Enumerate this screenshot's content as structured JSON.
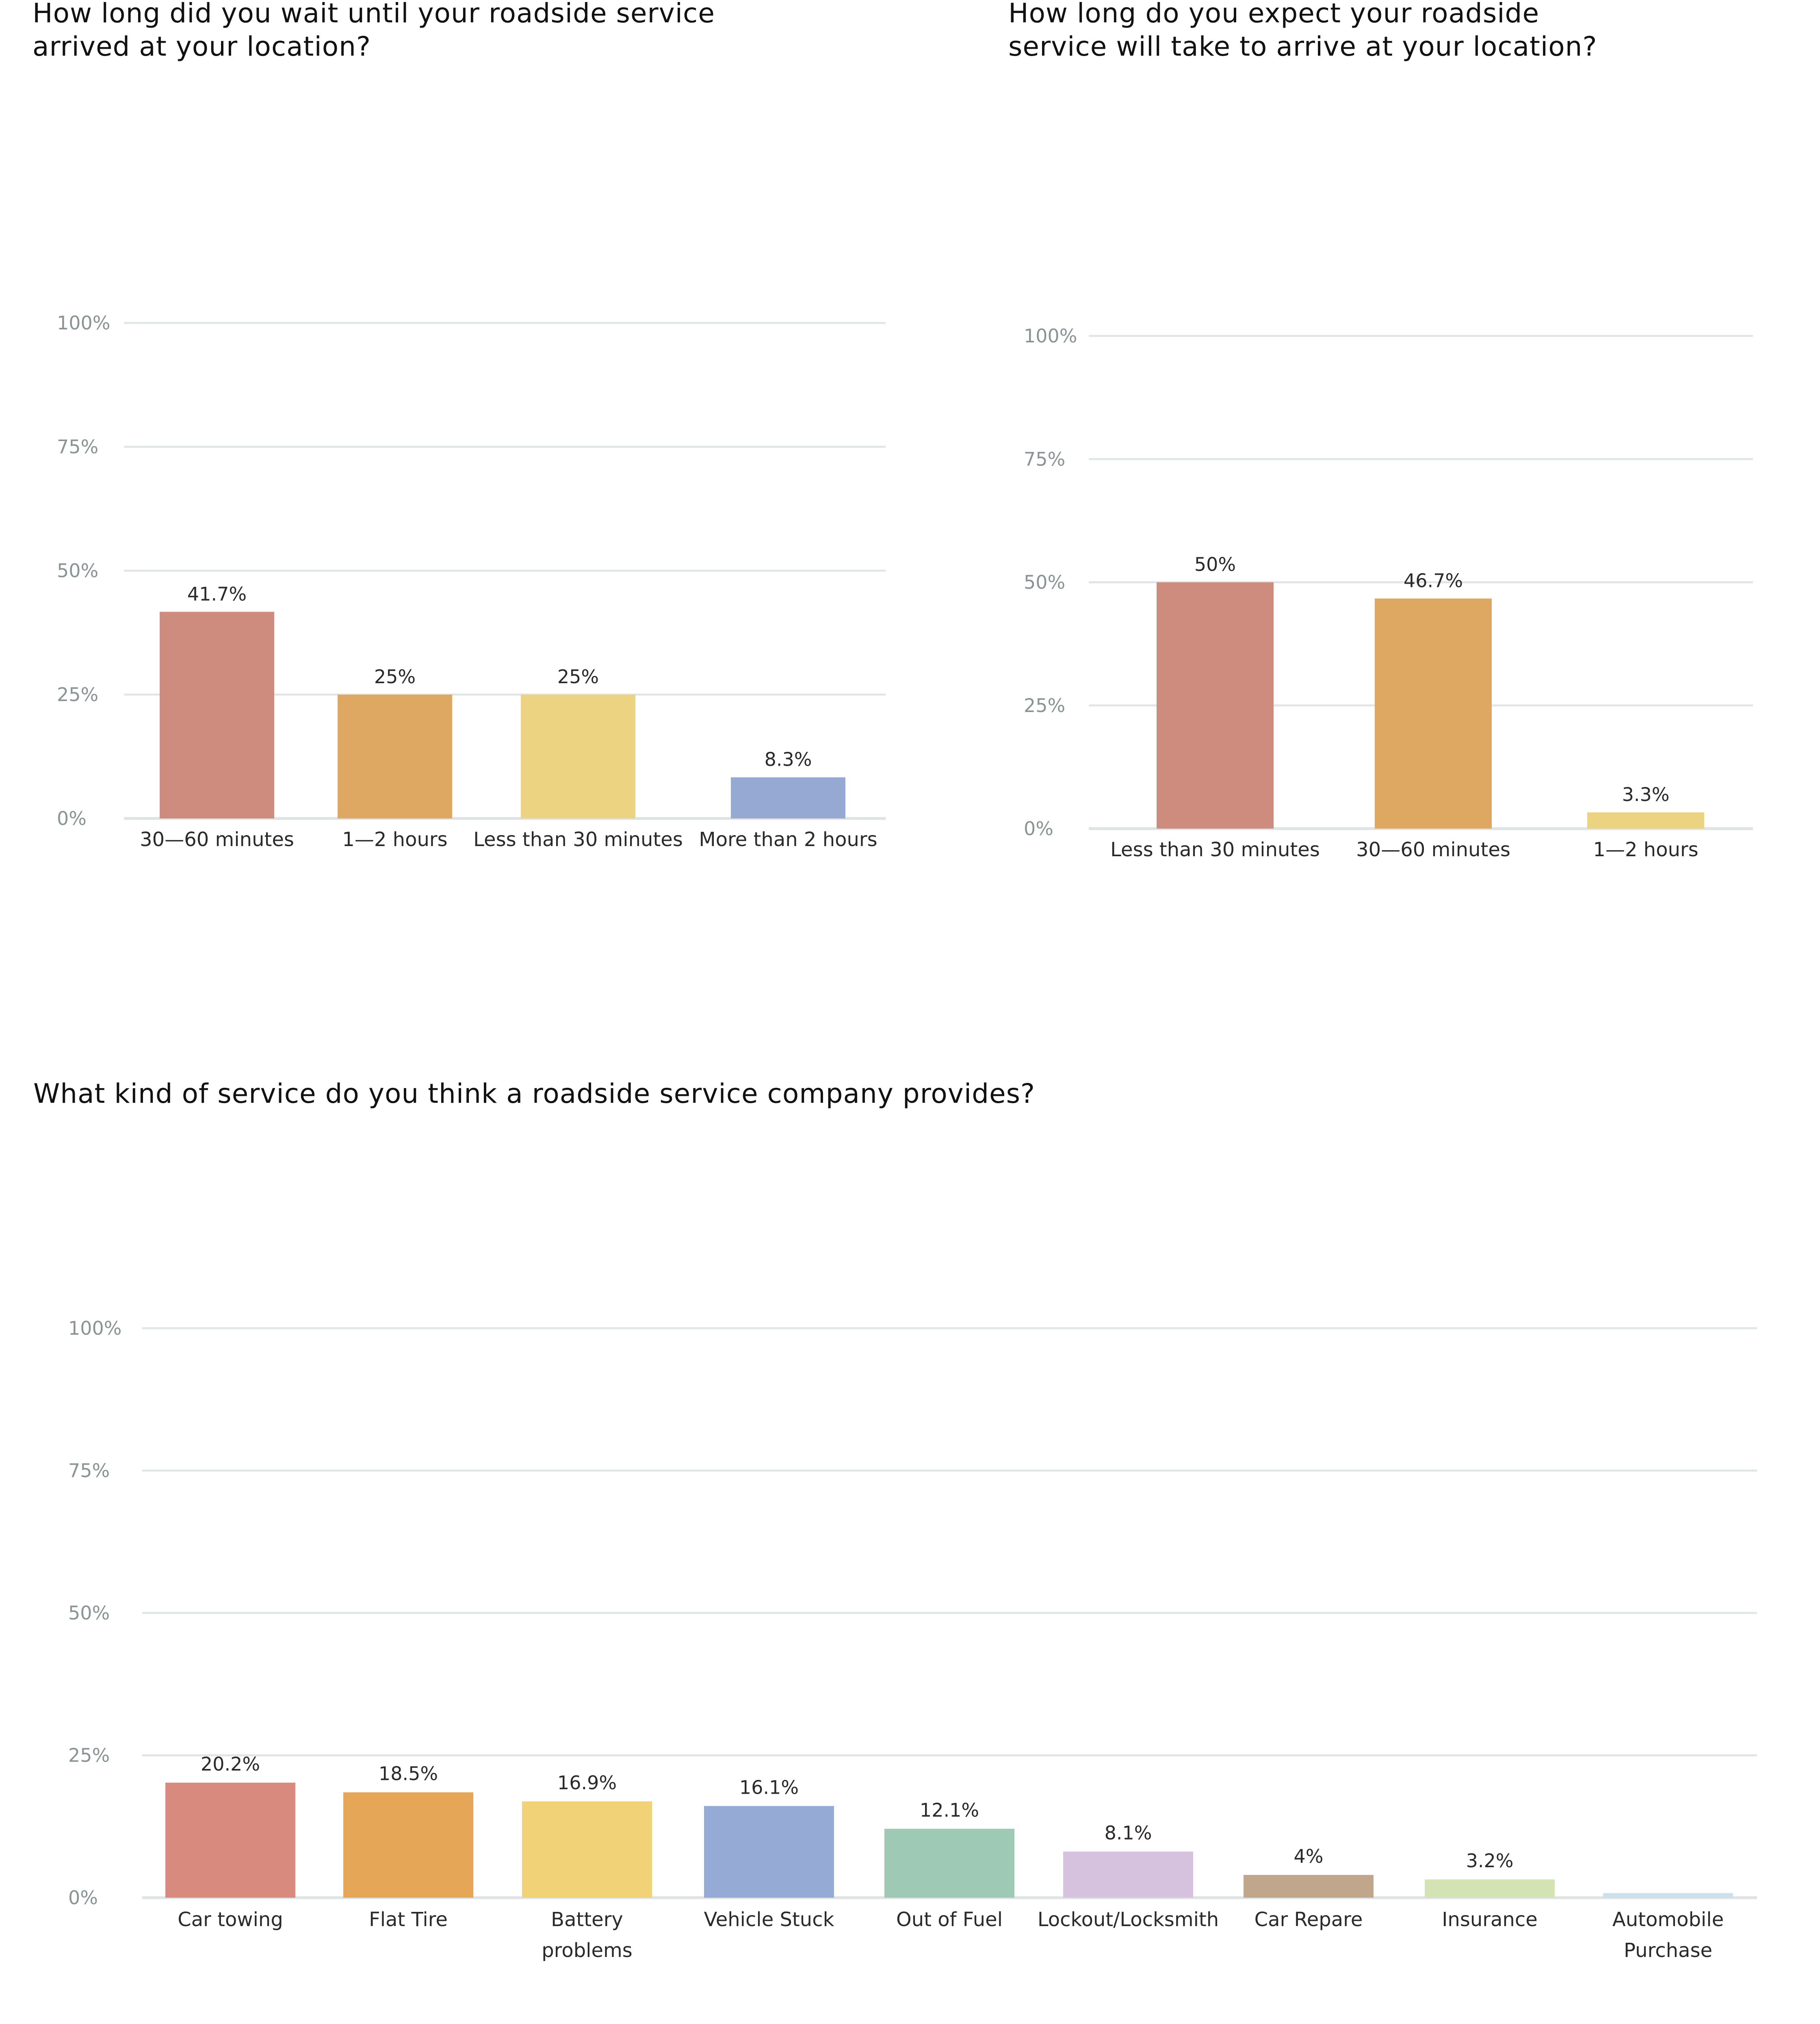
{
  "chart_data": [
    {
      "type": "bar",
      "title": "How long did you wait until your roadside service arrived at your location?",
      "title_lines": [
        "How long did you wait until your roadside service",
        "arrived at your location?"
      ],
      "categories": [
        "30—60 minutes",
        "1—2 hours",
        "Less than 30 minutes",
        "More than 2 hours"
      ],
      "values": [
        41.7,
        25,
        25,
        8.3
      ],
      "data_labels": [
        "41.7%",
        "25%",
        "25%",
        "8.3%"
      ],
      "colors": [
        "#cd8c7e",
        "#dea762",
        "#ecd382",
        "#96a9d2"
      ],
      "yticks": [
        "0%",
        "25%",
        "50%",
        "75%",
        "100%"
      ],
      "ylim": [
        0,
        100
      ],
      "xlabel": "",
      "ylabel": "",
      "grid": true,
      "legend": "none"
    },
    {
      "type": "bar",
      "title": "How long do you expect your roadside service will take to arrive at your location?",
      "title_lines": [
        "How long do you expect your roadside",
        "service will take to arrive at your location?"
      ],
      "categories": [
        "Less than 30 minutes",
        "30—60 minutes",
        "1—2 hours"
      ],
      "values": [
        50,
        46.7,
        3.3
      ],
      "data_labels": [
        "50%",
        "46.7%",
        "3.3%"
      ],
      "colors": [
        "#cd8c7e",
        "#dea762",
        "#ecd382"
      ],
      "yticks": [
        "0%",
        "25%",
        "50%",
        "75%",
        "100%"
      ],
      "ylim": [
        0,
        100
      ],
      "xlabel": "",
      "ylabel": "",
      "grid": true,
      "legend": "none"
    },
    {
      "type": "bar",
      "title": "What kind of service do you think a roadside service company provides?",
      "title_lines": [
        "What kind of service do you think a roadside service company provides?"
      ],
      "categories": [
        "Car towing",
        "Flat Tire",
        "Battery problems",
        "Vehicle Stuck",
        "Out of Fuel",
        "Lockout/Locksmith",
        "Car Repare",
        "Insurance",
        "Automobile Purchase"
      ],
      "category_lines": [
        [
          "Car towing"
        ],
        [
          "Flat Tire"
        ],
        [
          "Battery",
          "problems"
        ],
        [
          "Vehicle Stuck"
        ],
        [
          "Out of Fuel"
        ],
        [
          "Lockout/Locksmith"
        ],
        [
          "Car Repare"
        ],
        [
          "Insurance"
        ],
        [
          "Automobile",
          "Purchase"
        ]
      ],
      "values": [
        20.2,
        18.5,
        16.9,
        16.1,
        12.1,
        8.1,
        4,
        3.2,
        0.8
      ],
      "data_labels": [
        "20.2%",
        "18.5%",
        "16.9%",
        "16.1%",
        "12.1%",
        "8.1%",
        "4%",
        "3.2%",
        ""
      ],
      "colors": [
        "#d98a7e",
        "#e5a657",
        "#f1d276",
        "#95aad5",
        "#9ecab5",
        "#d6c1df",
        "#c0a68b",
        "#d4e3b3",
        "#cbe0ec"
      ],
      "yticks": [
        "0%",
        "25%",
        "50%",
        "75%",
        "100%"
      ],
      "ylim": [
        0,
        100
      ],
      "xlabel": "",
      "ylabel": "",
      "grid": true,
      "legend": "none"
    }
  ]
}
